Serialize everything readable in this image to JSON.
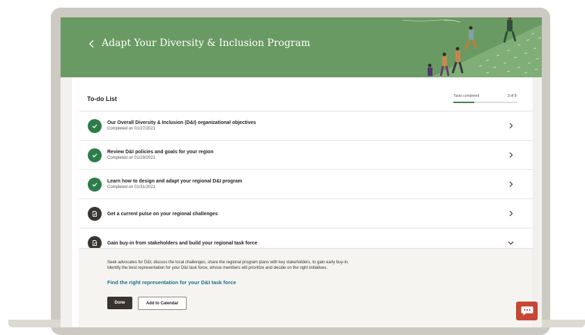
{
  "banner": {
    "title": "Adapt Your Diversity & Inclusion Program",
    "color": "#6a9a63"
  },
  "todo": {
    "title": "To-do List",
    "progress_label": "Tasks completed",
    "progress_count": "3 of 9",
    "progress_fraction": 0.33,
    "progress_color": "#3e7f4c"
  },
  "tasks": [
    {
      "title": "Our Overall Diversity & Inclusion (D&I) organizational objectives",
      "subtitle": "Completed on 01/27/2021",
      "status": "completed",
      "icon": "check-icon"
    },
    {
      "title": "Review D&I policies and goals for your region",
      "subtitle": "Completed on 01/29/2021",
      "status": "completed",
      "icon": "check-icon"
    },
    {
      "title": "Learn how to design and adapt your regional D&I program",
      "subtitle": "Completed on 01/31/2021",
      "status": "completed",
      "icon": "check-icon"
    },
    {
      "title": "Get a current pulse on your regional challenges",
      "subtitle": "",
      "status": "pending",
      "icon": "document-edit-icon"
    },
    {
      "title": "Gain buy-in from stakeholders and build your regional task force",
      "subtitle": "",
      "status": "pending",
      "icon": "document-edit-icon",
      "expanded": true
    }
  ],
  "expanded_task": {
    "description_line1": "Seek advocates for D&I, discuss the local challenges, share the regional program plans with key stakeholders, to gain early buy-in.",
    "description_line2": "Identify the best representation for your D&I task force, whose members will prioritize and decide on the right initiatives.",
    "link": "Find the right representation for your D&I task force",
    "done_label": "Done",
    "calendar_label": "Add to Calendar"
  },
  "chat": {
    "icon": "chat-icon",
    "color": "#c74634"
  }
}
